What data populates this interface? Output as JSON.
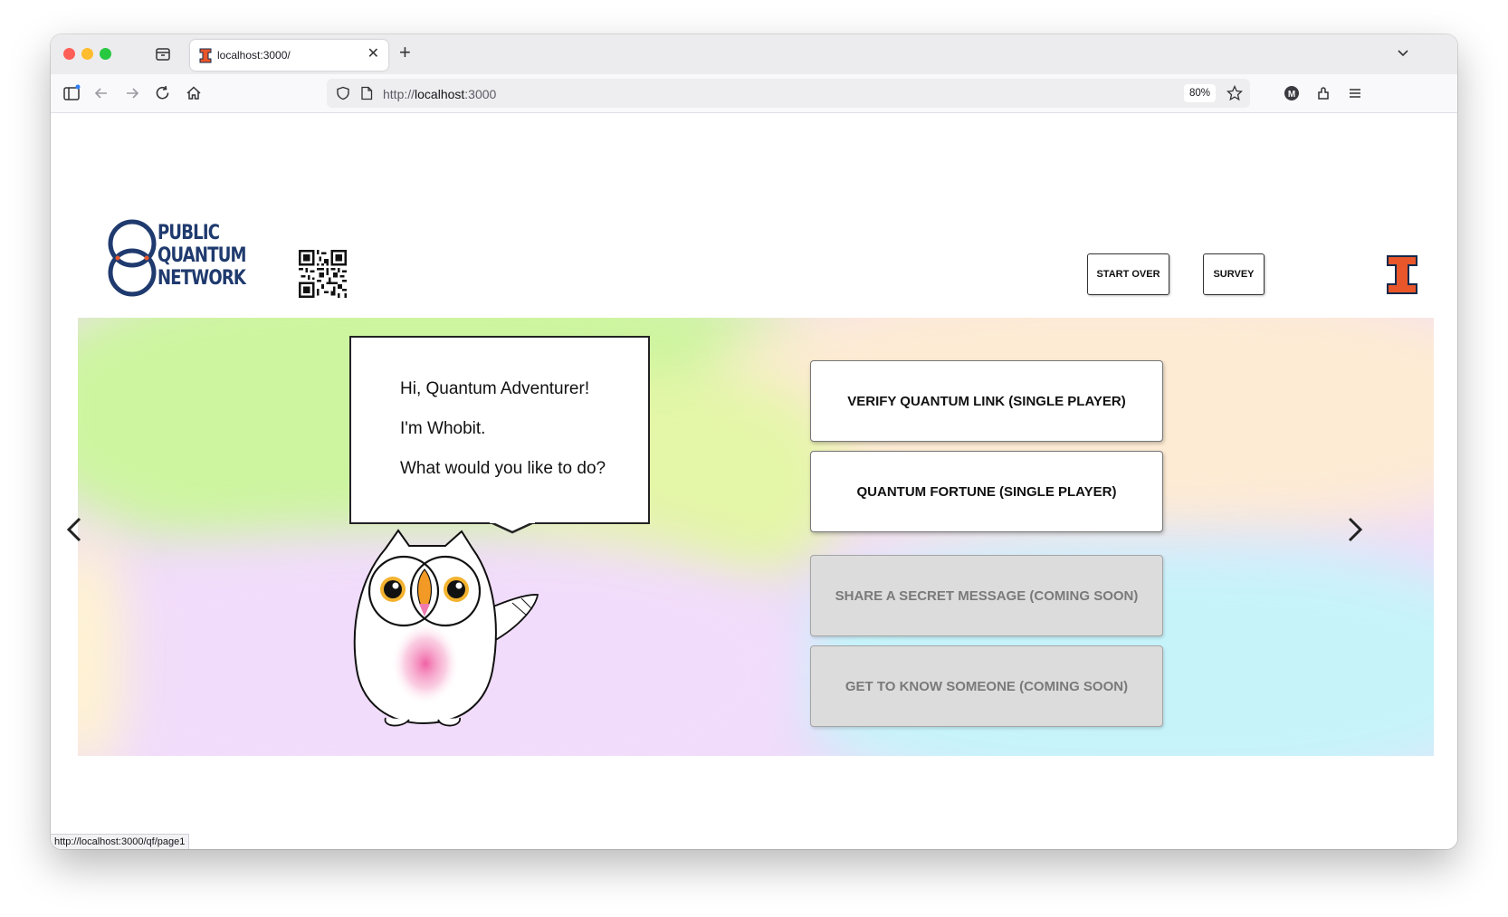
{
  "browser": {
    "tab_title": "localhost:3000/",
    "url_scheme": "http://",
    "url_host": "localhost",
    "url_port": ":3000",
    "zoom": "80%",
    "status_link": "http://localhost:3000/qf/page1"
  },
  "header": {
    "logo_lines": [
      "PUBLIC",
      "QUANTUM",
      "NETWORK"
    ],
    "start_over_label": "START OVER",
    "survey_label": "SURVEY"
  },
  "dialog": {
    "line1": "Hi, Quantum Adventurer!",
    "line2": "I'm Whobit.",
    "line3": "What would you like to do?"
  },
  "choices": [
    {
      "label": "VERIFY QUANTUM LINK (SINGLE PLAYER)",
      "enabled": true
    },
    {
      "label": "QUANTUM FORTUNE (SINGLE PLAYER)",
      "enabled": true
    },
    {
      "label": "SHARE A SECRET MESSAGE (COMING SOON)",
      "enabled": false
    },
    {
      "label": "GET TO KNOW SOMEONE (COMING SOON)",
      "enabled": false
    }
  ],
  "colors": {
    "logo_navy": "#1f3a6e",
    "illinois_orange": "#e8562a",
    "panel_green": "#cdf5a0",
    "panel_peach": "#fdebd4",
    "panel_lavender": "#f1dcfb",
    "panel_cyan": "#c6f3fa"
  },
  "icons": [
    "sidebar-icon",
    "back-icon",
    "forward-icon",
    "reload-icon",
    "home-icon",
    "shield-icon",
    "page-icon",
    "star-icon",
    "account-icon",
    "extensions-icon",
    "menu-icon",
    "chevron-left-icon",
    "chevron-right-icon"
  ]
}
